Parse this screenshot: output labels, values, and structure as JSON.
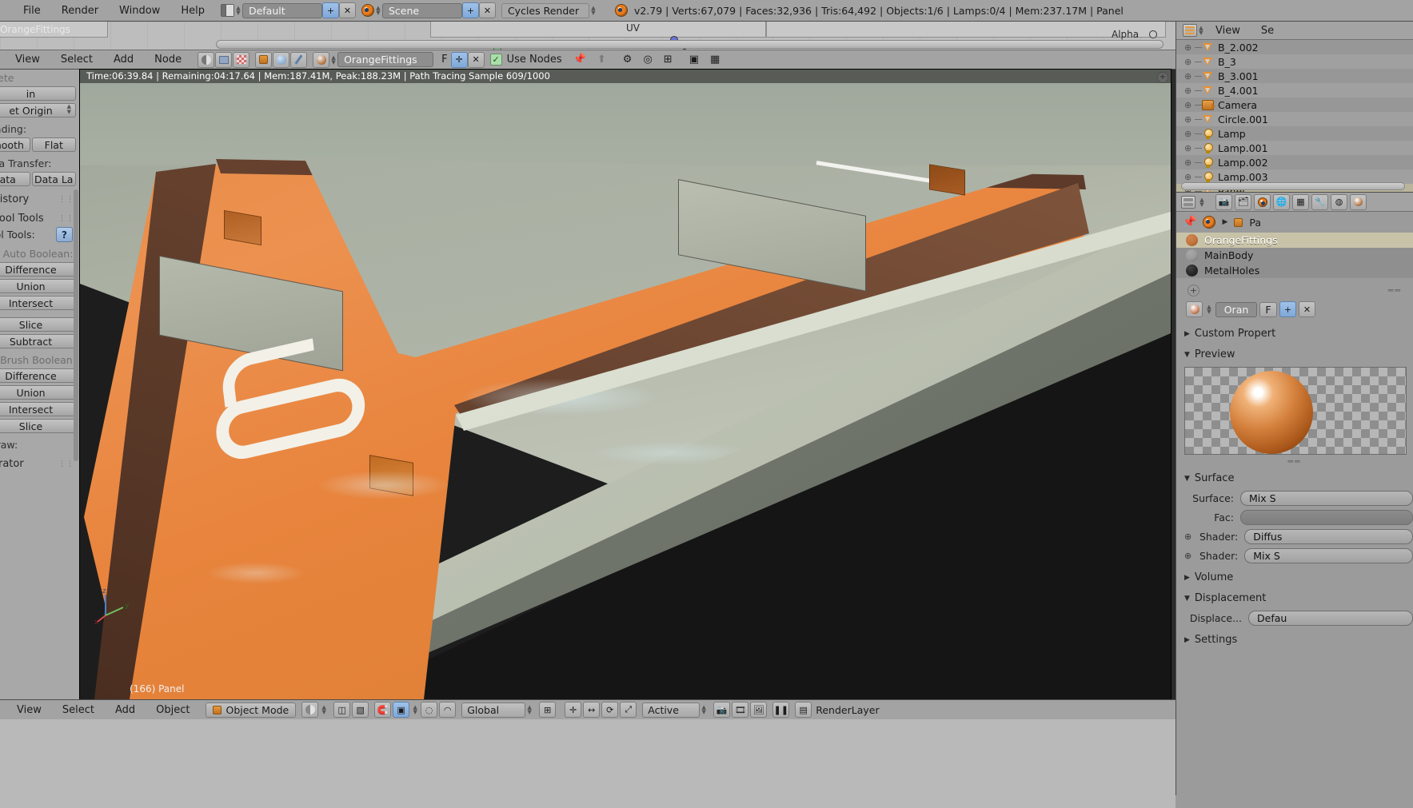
{
  "topbar": {
    "menus": [
      "File",
      "Render",
      "Window",
      "Help"
    ],
    "screen_layout": "Default",
    "scene": "Scene",
    "engine": "Cycles Render",
    "stats": "v2.79 | Verts:67,079 | Faces:32,936 | Tris:64,492 | Objects:1/6 | Lamps:0/4 | Mem:237.17M | Panel",
    "add_label": "+",
    "remove_label": "✕"
  },
  "node_editor": {
    "menus": [
      "View",
      "Select",
      "Add",
      "Node"
    ],
    "material_name": "OrangeFittings",
    "fake_user_label": "F",
    "use_nodes_label": "Use Nodes",
    "node_labels": [
      "UV",
      "Alpha"
    ],
    "tab_label": "OrangeFittings"
  },
  "toolshelf": {
    "buttons_top": [
      "in",
      "et Origin"
    ],
    "shading_label": "hading:",
    "shading_buttons": [
      "mooth",
      "Flat"
    ],
    "data_transfer_label": "ata Transfer:",
    "data_buttons": [
      "ata",
      "Data La"
    ],
    "panels": [
      "History",
      "Bool Tools"
    ],
    "bool_tools_label": "ool Tools:",
    "help_icon": "question-icon",
    "auto_boolean_label": "Auto Boolean:",
    "auto_boolean_buttons": [
      "Difference",
      "Union",
      "Intersect",
      "Slice",
      "Subtract"
    ],
    "brush_boolean_label": "Brush Boolean:",
    "brush_boolean_buttons": [
      "Difference",
      "Union",
      "Intersect",
      "Slice"
    ],
    "draw_label": "Draw:",
    "operator_label": "erator"
  },
  "viewport": {
    "render_info": "Time:06:39.84 | Remaining:04:17.64 | Mem:187.41M, Peak:188.23M | Path Tracing Sample 609/1000",
    "object_label": "(166) Panel",
    "axis_labels": [
      "z",
      "y",
      "x"
    ]
  },
  "outliner": {
    "menus": [
      "View",
      "Se"
    ],
    "items": [
      {
        "name": "B_2.002",
        "icon": "mesh-icon",
        "selected": false
      },
      {
        "name": "B_3",
        "icon": "mesh-icon",
        "selected": false
      },
      {
        "name": "B_3.001",
        "icon": "mesh-icon",
        "selected": false
      },
      {
        "name": "B_4.001",
        "icon": "mesh-icon",
        "selected": false
      },
      {
        "name": "Camera",
        "icon": "camera-icon",
        "selected": false
      },
      {
        "name": "Circle.001",
        "icon": "mesh-icon",
        "selected": false
      },
      {
        "name": "Lamp",
        "icon": "lamp-icon",
        "selected": false
      },
      {
        "name": "Lamp.001",
        "icon": "lamp-icon",
        "selected": false
      },
      {
        "name": "Lamp.002",
        "icon": "lamp-icon",
        "selected": false
      },
      {
        "name": "Lamp.003",
        "icon": "lamp-icon",
        "selected": false
      },
      {
        "name": "Panel",
        "icon": "mesh-icon",
        "selected": true
      }
    ]
  },
  "properties": {
    "breadcrumb_object": "Pa",
    "material_slots": [
      {
        "name": "OrangeFittings",
        "color": "#c4743a",
        "selected": true
      },
      {
        "name": "MainBody",
        "color": "#9a9a9a",
        "selected": false
      },
      {
        "name": "MetalHoles",
        "color": "#262626",
        "selected": false
      }
    ],
    "add_slot_label": "+",
    "material_datablock": "Oran",
    "fake_user_label": "F",
    "new_label": "+",
    "unlink_label": "✕",
    "sections": [
      {
        "label": "Custom Propert",
        "open": false
      },
      {
        "label": "Preview",
        "open": true
      },
      {
        "label": "Surface",
        "open": true
      },
      {
        "label": "Volume",
        "open": false
      },
      {
        "label": "Displacement",
        "open": true
      },
      {
        "label": "Settings",
        "open": false
      }
    ],
    "surface_rows": [
      {
        "label": "Surface:",
        "value": "Mix S"
      },
      {
        "label": "Fac:",
        "value": ""
      },
      {
        "label": "Shader:",
        "value": "Diffus"
      },
      {
        "label": "Shader:",
        "value": "Mix S"
      }
    ],
    "displacement_row": {
      "label": "Displace...",
      "value": "Defau"
    }
  },
  "bottombar": {
    "menus": [
      "View",
      "Select",
      "Add",
      "Object"
    ],
    "mode": "Object Mode",
    "transform_orientation": "Global",
    "pivot_label": "Active",
    "render_layer": "RenderLayer"
  },
  "colors": {
    "header": "#a3a3a3",
    "panel": "#9b9b9b",
    "accent_blue": "#7fa8d8",
    "accent_orange": "#e8873a",
    "selected_row": "#c8c3a8"
  }
}
